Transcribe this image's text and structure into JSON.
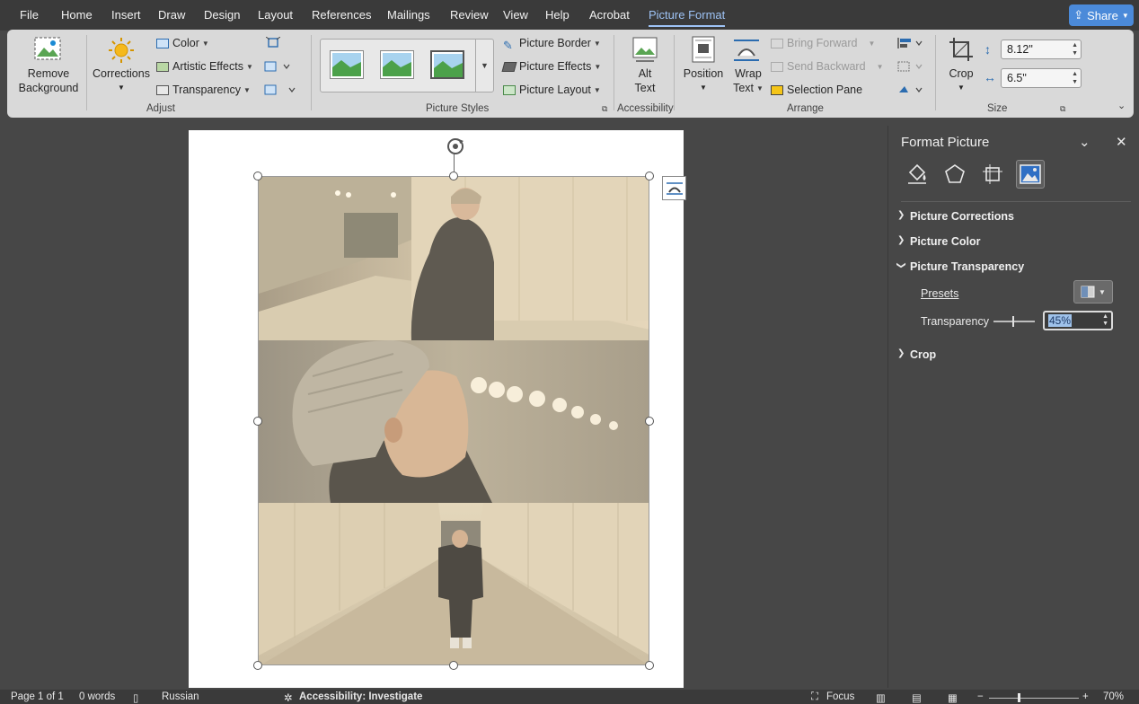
{
  "menu": {
    "tabs": [
      "File",
      "Home",
      "Insert",
      "Draw",
      "Design",
      "Layout",
      "References",
      "Mailings",
      "Review",
      "View",
      "Help",
      "Acrobat",
      "Picture Format"
    ],
    "active_tab": "Picture Format",
    "share_label": "Share"
  },
  "ribbon": {
    "adjust": {
      "remove_bg_line1": "Remove",
      "remove_bg_line2": "Background",
      "corrections": "Corrections",
      "color": "Color",
      "artistic_effects": "Artistic Effects",
      "transparency": "Transparency",
      "group_label": "Adjust"
    },
    "picture_styles": {
      "picture_border": "Picture Border",
      "picture_effects": "Picture Effects",
      "picture_layout": "Picture Layout",
      "group_label": "Picture Styles"
    },
    "accessibility": {
      "alt_line1": "Alt",
      "alt_line2": "Text",
      "group_label": "Accessibility"
    },
    "arrange": {
      "position": "Position",
      "wrap_line1": "Wrap",
      "wrap_line2": "Text",
      "bring_forward": "Bring Forward",
      "send_backward": "Send Backward",
      "selection_pane": "Selection Pane",
      "group_label": "Arrange"
    },
    "size": {
      "crop": "Crop",
      "height": "8.12\"",
      "width": "6.5\"",
      "group_label": "Size"
    }
  },
  "format_pane": {
    "title": "Format Picture",
    "sections": {
      "corrections": "Picture Corrections",
      "color": "Picture Color",
      "transparency": "Picture Transparency",
      "crop": "Crop"
    },
    "presets_label": "Presets",
    "transparency_label": "Transparency",
    "transparency_value": "45%",
    "transparency_fraction": 0.45
  },
  "status": {
    "page": "Page 1 of 1",
    "words": "0 words",
    "language": "Russian",
    "accessibility": "Accessibility: Investigate",
    "focus": "Focus",
    "zoom": "70%"
  },
  "colors": {
    "accent": "#9ec3f5",
    "share": "#4b8ad9",
    "ribbon_bg": "#d9d9d9",
    "app_bg": "#474747"
  }
}
